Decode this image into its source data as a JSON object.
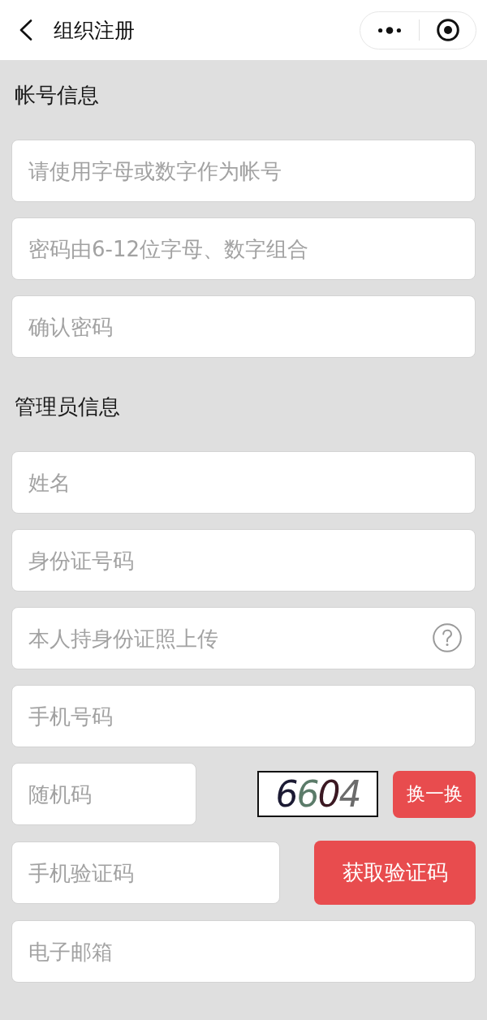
{
  "header": {
    "title": "组织注册"
  },
  "sections": [
    {
      "heading": "帐号信息",
      "fields": [
        {
          "kind": "text",
          "placeholder": "请使用字母或数字作为帐号"
        },
        {
          "kind": "text",
          "placeholder": "密码由6-12位字母、数字组合"
        },
        {
          "kind": "text",
          "placeholder": "确认密码"
        }
      ]
    },
    {
      "heading": "管理员信息",
      "fields": [
        {
          "kind": "text",
          "placeholder": "姓名"
        },
        {
          "kind": "text",
          "placeholder": "身份证号码"
        },
        {
          "kind": "upload",
          "placeholder": "本人持身份证照上传"
        },
        {
          "kind": "text",
          "placeholder": "手机号码"
        },
        {
          "kind": "captcha",
          "placeholder": "随机码",
          "captcha": "6604",
          "button": "换一换"
        },
        {
          "kind": "sms",
          "placeholder": "手机验证码",
          "button": "获取验证码"
        },
        {
          "kind": "text",
          "placeholder": "电子邮箱"
        }
      ]
    }
  ]
}
